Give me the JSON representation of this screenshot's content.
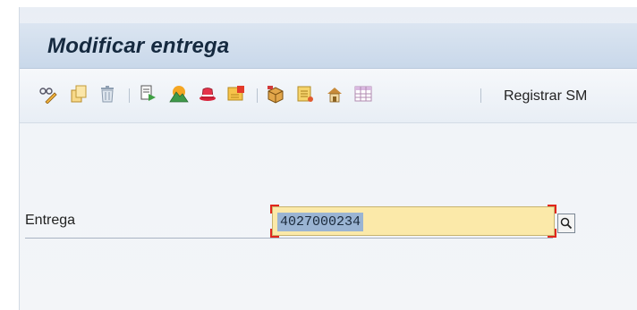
{
  "window": {
    "title": "Modificar entrega"
  },
  "toolbar": {
    "icons": [
      "display-change-icon",
      "create-icon",
      "delete-icon",
      "copy-document-icon",
      "mountain-icon",
      "hat-icon",
      "stamp-icon",
      "package-icon",
      "document-list-icon",
      "house-arrow-icon",
      "table-icon"
    ],
    "post_goods_issue_label": "Registrar SM"
  },
  "form": {
    "delivery": {
      "label": "Entrega",
      "value": "4027000234"
    }
  },
  "colors": {
    "title_bar": "#c9d8ea",
    "title_text": "#15293f",
    "input_bg": "#fbe9a9",
    "selection": "#9ab4d3",
    "required_marker": "#e1261c"
  }
}
